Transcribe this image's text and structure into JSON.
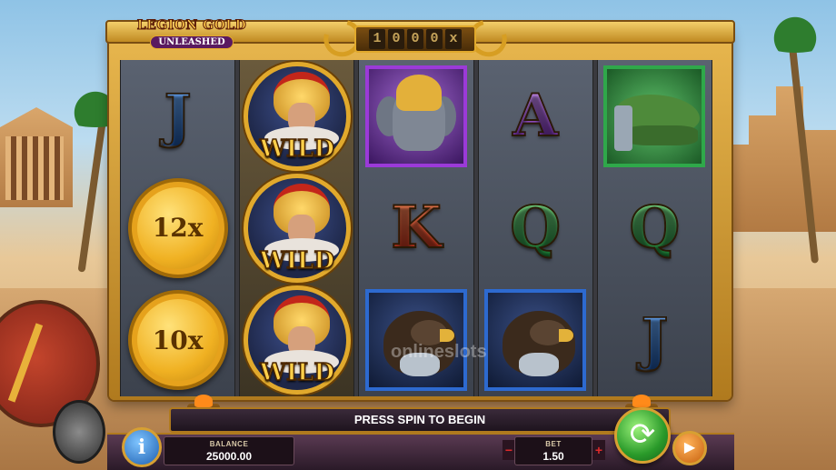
{
  "game": {
    "logo_line1": "LEGION GOLD",
    "logo_line2": "UNLEASHED",
    "multiplier_digits": [
      "1",
      "0",
      "0",
      "0",
      "x"
    ]
  },
  "reels": [
    [
      {
        "type": "letter",
        "value": "J",
        "color": "blue"
      },
      {
        "type": "coin",
        "value": "12x"
      },
      {
        "type": "coin",
        "value": "10x"
      }
    ],
    [
      {
        "type": "wild",
        "value": "WILD"
      },
      {
        "type": "wild",
        "value": "WILD"
      },
      {
        "type": "wild",
        "value": "WILD"
      }
    ],
    [
      {
        "type": "symbol",
        "value": "elephant-icon"
      },
      {
        "type": "letter",
        "value": "K",
        "color": "red"
      },
      {
        "type": "symbol",
        "value": "eagle-icon"
      }
    ],
    [
      {
        "type": "letter",
        "value": "A",
        "color": "purple"
      },
      {
        "type": "letter",
        "value": "Q",
        "color": "green"
      },
      {
        "type": "symbol",
        "value": "eagle-icon"
      }
    ],
    [
      {
        "type": "symbol",
        "value": "crocodile-icon"
      },
      {
        "type": "letter",
        "value": "Q",
        "color": "green"
      },
      {
        "type": "letter",
        "value": "J",
        "color": "blue"
      }
    ]
  ],
  "message": "PRESS SPIN TO BEGIN",
  "controls": {
    "info_label": "i",
    "balance_label": "BALANCE",
    "balance_value": "25000.00",
    "bet_label": "BET",
    "bet_value": "1.50",
    "bet_minus": "−",
    "bet_plus": "+",
    "spin_icon": "spin-arrows-icon",
    "autoplay_icon": "autoplay-icon"
  },
  "watermark": "onlineslots",
  "colors": {
    "frame_gold": "#e1a92c",
    "spin_green": "#2a9a2a",
    "info_blue": "#1e5fb0",
    "bet_arrow_red": "#e02a2a"
  }
}
